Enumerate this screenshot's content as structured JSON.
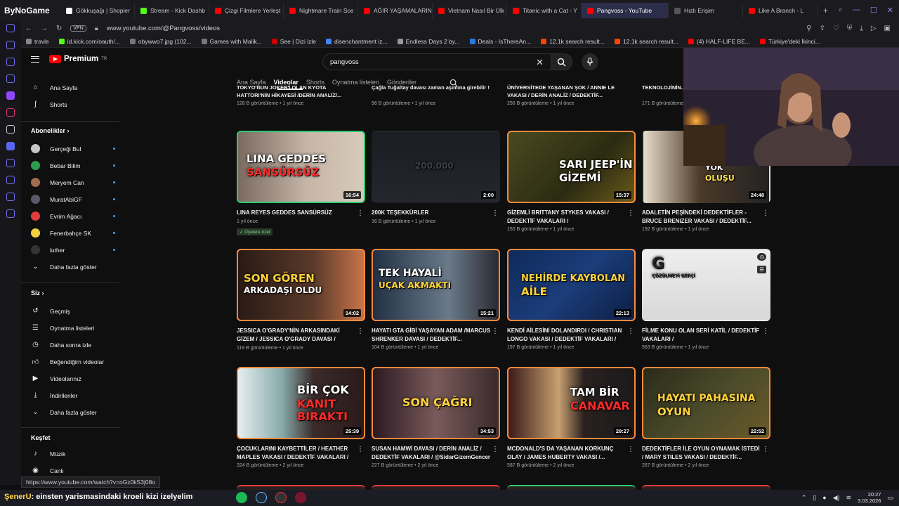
{
  "browser": {
    "brand": "ByNoGame",
    "tabs": [
      {
        "label": "Gökkuşağı | Shopier",
        "color": "#ffffff"
      },
      {
        "label": "Stream - Kick Dashb",
        "color": "#53fc18"
      },
      {
        "label": "Çizgi Filmlere Yerleşt",
        "color": "#ff0000"
      },
      {
        "label": "Nightmare Train Sce",
        "color": "#ff0000"
      },
      {
        "label": "AĞIR YAŞAMALARIN E",
        "color": "#ff0000"
      },
      {
        "label": "Vietnam Nasıl Bir Ülk",
        "color": "#ff0000"
      },
      {
        "label": "Titanic with a Cat - Y",
        "color": "#ff0000"
      },
      {
        "label": "Pangvoss - YouTube",
        "color": "#ff0000",
        "active": true
      },
      {
        "label": "Hızlı Erişim",
        "color": "#555"
      },
      {
        "label": "Like A Branch - L",
        "color": "#ff0000"
      }
    ],
    "address": "www.youtube.com/@Pangvoss/videos",
    "vpn_label": "VPN",
    "bookmarks": [
      {
        "label": "travle",
        "color": "#888"
      },
      {
        "label": "id.kick.com/oauth/...",
        "color": "#53fc18"
      },
      {
        "label": "obywwo7.jpg (102...",
        "color": "#777"
      },
      {
        "label": "Games with Malik...",
        "color": "#777"
      },
      {
        "label": "See | Dizi izle",
        "color": "#c00"
      },
      {
        "label": "disenchantment iz...",
        "color": "#4285f4"
      },
      {
        "label": "Endless Days 2 by...",
        "color": "#999"
      },
      {
        "label": "Deals - IsThereAn...",
        "color": "#2a7ae2"
      },
      {
        "label": "12.1k search result...",
        "color": "#ff4500"
      },
      {
        "label": "12.1k search result...",
        "color": "#ff4500"
      },
      {
        "label": "(4) HALF-LIFE BE...",
        "color": "#ff0000"
      },
      {
        "label": "Türkiye'deki İkinci...",
        "color": "#ff0000"
      }
    ]
  },
  "youtube": {
    "logo_text": "Premium",
    "logo_region": "TR",
    "search": {
      "query": "pangvoss"
    },
    "sidebar": {
      "main": [
        {
          "label": "Ana Sayfa",
          "icon": "home-icon"
        },
        {
          "label": "Shorts",
          "icon": "shorts-icon"
        }
      ],
      "subs_header": "Abonelikler  ›",
      "subs": [
        {
          "label": "Gerçeği Bul",
          "color": "#c8c8c8"
        },
        {
          "label": "Bebar Bilim",
          "color": "#2e9b4f"
        },
        {
          "label": "Meryem Can",
          "color": "#a06b52"
        },
        {
          "label": "MuratAbiGF",
          "color": "#5a5a6a"
        },
        {
          "label": "Evrim Ağacı",
          "color": "#e23b3b"
        },
        {
          "label": "Fenerbahçe SK",
          "color": "#f2d23c"
        },
        {
          "label": "luther",
          "color": "#333"
        }
      ],
      "subs_more": "Daha fazla göster",
      "you_header": "Siz  ›",
      "you": [
        {
          "label": "Geçmiş",
          "icon": "history-icon"
        },
        {
          "label": "Oynatma listeleri",
          "icon": "playlist-icon"
        },
        {
          "label": "Daha sonra izle",
          "icon": "clock-icon"
        },
        {
          "label": "Beğendiğim videolar",
          "icon": "like-icon"
        },
        {
          "label": "Videolarınız",
          "icon": "video-icon"
        },
        {
          "label": "İndirilenler",
          "icon": "download-icon"
        },
        {
          "label": "Daha fazla göster",
          "icon": "chevron-down-icon"
        }
      ],
      "explore_header": "Keşfet",
      "explore": [
        {
          "label": "Müzik",
          "icon": "music-icon"
        },
        {
          "label": "Canlı",
          "icon": "live-icon"
        }
      ]
    },
    "channel_tabs": [
      "Ana Sayfa",
      "Videolar",
      "Shorts",
      "Oynatma listeleri",
      "Gönderiler"
    ],
    "active_tab": "Videolar",
    "partial_row": [
      {
        "title": "TOKYO'NUN JOKER'İ OLAN KYOTA HATTORI'NİN HİKAYESİ /DERİN ANALİZ/...",
        "meta": "128 B görüntüleme • 1 yıl önce"
      },
      {
        "title": "Çağla Tuğaltay davası zaman aşımına girebilir !",
        "meta": "56 B görüntüleme • 1 yıl önce"
      },
      {
        "title": "ÜNİVERSİTEDE YAŞANAN ŞOK / ANNIE LE VAKASI / DERİN ANALİZ / DEDEKTİF...",
        "meta": "256 B görüntüleme • 1 yıl önce"
      },
      {
        "title": "TEKNOLOJİNİN... OLAY / LINA RE...",
        "meta": "171 B görüntüleme"
      }
    ],
    "videos": [
      {
        "title": "LINA REYES GEDDES SANSÜRSÜZ",
        "meta": "1 yıl önce",
        "duration": "16:54",
        "thumb_text": "LINA GEDDES",
        "thumb_sub": "SANSÜRSÜZ",
        "members": "Üyelere özel"
      },
      {
        "title": "200K TEŞEKKÜRLER",
        "meta": "16 B görüntüleme • 1 yıl önce",
        "duration": "2:00",
        "thumb_text": "200.000",
        "thumb_sub": ""
      },
      {
        "title": "GİZEMLİ BRITTANY STYKES VAKASI / DEDEKTİF VAKALARI /",
        "meta": "150 B görüntüleme • 1 yıl önce",
        "duration": "15:37",
        "thumb_text": "SARI JEEP'İN",
        "thumb_sub": "GİZEMİ"
      },
      {
        "title": "ADALETİN PEŞİNDEKİ DEDEKTİFLER - BRUCE BRENIZER VAKASI / DEDEKTİF...",
        "meta": "192 B görüntüleme • 1 yıl önce",
        "duration": "24:48",
        "thumb_text": "YOK",
        "thumb_sub": "OLUŞU"
      },
      {
        "title": "JESSICA O'GRADY'NİN ARKASINDAKİ GİZEM / JESSICA O'GRADY DAVASI / DEDEKTİF...",
        "meta": "119 B görüntüleme • 1 yıl önce",
        "duration": "14:02",
        "thumb_text": "SON GÖREN",
        "thumb_sub": "ARKADAŞI OLDU"
      },
      {
        "title": "HAYATI GTA GİBİ YAŞAYAN ADAM /MARCUS SHRENKER DAVASI / DEDEKTİF...",
        "meta": "104 B görüntüleme • 1 yıl önce",
        "duration": "15:21",
        "thumb_text": "TEK HAYALİ",
        "thumb_sub": "UÇAK AKMAKTI"
      },
      {
        "title": "KENDİ AİLESİNİ DOLANDIRDI / CHRISTIAN LONGO VAKASI / DEDEKTİF VAKALARI /",
        "meta": "197 B görüntüleme • 1 yıl önce",
        "duration": "22:13",
        "thumb_text": "NEHİRDE KAYBOLAN",
        "thumb_sub": "AİLE"
      },
      {
        "title": "FİLME KONU OLAN SERİ KATİL / DEDEKTİF VAKALARI /",
        "meta": "563 B görüntüleme • 1 yıl önce",
        "duration": "",
        "thumb_text": "G",
        "thumb_sub": "ÇÖZÜLMEYİ GERÇİ"
      },
      {
        "title": "ÇOCUKLARINI KAYBETTİLER / HEATHER MAPLES VAKASI / DEDEKTİF VAKALARI /",
        "meta": "324 B görüntüleme • 2 yıl önce",
        "duration": "25:39",
        "thumb_text": "BİR ÇOK",
        "thumb_sub": "KANIT BIRAKTI"
      },
      {
        "title": "SUSAN HAMWİ DAVASI / DERİN ANALİZ / DEDEKTİF VAKALARI / @SidarGizemGencer",
        "meta": "227 B görüntüleme • 2 yıl önce",
        "duration": "34:53",
        "thumb_text": "SON ÇAĞRI",
        "thumb_sub": ""
      },
      {
        "title": "MCDONALD'S DA YAŞANAN KORKUNÇ OLAY / JAMES HUBERTY VAKASI /...",
        "meta": "587 B görüntüleme • 2 yıl önce",
        "duration": "29:27",
        "thumb_text": "TAM BİR",
        "thumb_sub": "CANAVAR"
      },
      {
        "title": "DEDEKTİFLER İLE OYUN OYNAMAK İSTEDİ / MARY STILES VAKASI / DEDEKTİF...",
        "meta": "267 B görüntüleme • 2 yıl önce",
        "duration": "22:52",
        "thumb_text": "HAYATI PAHASINA",
        "thumb_sub": "OYUN"
      }
    ]
  },
  "status_url": "https://www.youtube.com/watch?v=oGz0kS3j08o",
  "taskbar": {
    "ticker_name": "ŞenerU",
    "ticker_text": ": einsten yarismasindaki kroeli kizi izelyelim",
    "time": "20:27",
    "date": "3.03.2026"
  }
}
